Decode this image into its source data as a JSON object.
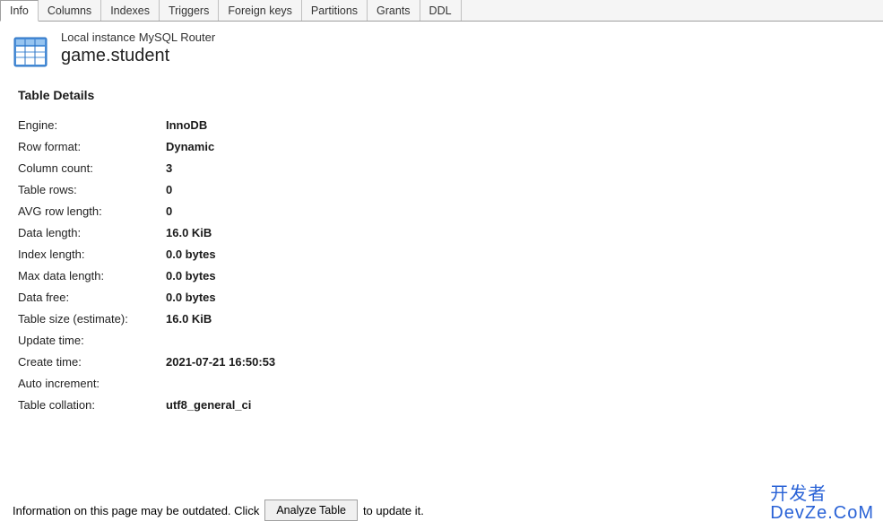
{
  "tabs": {
    "info": "Info",
    "columns": "Columns",
    "indexes": "Indexes",
    "triggers": "Triggers",
    "foreign_keys": "Foreign keys",
    "partitions": "Partitions",
    "grants": "Grants",
    "ddl": "DDL"
  },
  "header": {
    "connection": "Local instance MySQL Router",
    "table_name": "game.student"
  },
  "section_title": "Table Details",
  "details": {
    "engine": {
      "label": "Engine:",
      "value": "InnoDB"
    },
    "row_format": {
      "label": "Row format:",
      "value": "Dynamic"
    },
    "column_count": {
      "label": "Column count:",
      "value": "3"
    },
    "table_rows": {
      "label": "Table rows:",
      "value": "0"
    },
    "avg_row_length": {
      "label": "AVG row length:",
      "value": "0"
    },
    "data_length": {
      "label": "Data length:",
      "value": "16.0 KiB"
    },
    "index_length": {
      "label": "Index length:",
      "value": "0.0 bytes"
    },
    "max_data_length": {
      "label": "Max data length:",
      "value": "0.0 bytes"
    },
    "data_free": {
      "label": "Data free:",
      "value": "0.0 bytes"
    },
    "table_size": {
      "label": "Table size (estimate):",
      "value": "16.0 KiB"
    },
    "update_time": {
      "label": "Update time:",
      "value": ""
    },
    "create_time": {
      "label": "Create time:",
      "value": "2021-07-21 16:50:53"
    },
    "auto_increment": {
      "label": "Auto increment:",
      "value": ""
    },
    "table_collation": {
      "label": "Table collation:",
      "value": "utf8_general_ci"
    }
  },
  "footer": {
    "prefix": "Information on this page may be outdated. Click",
    "button": "Analyze Table",
    "suffix": "to update it."
  },
  "watermark": {
    "line1": "开发者",
    "line2": "DevZe.CoM"
  }
}
